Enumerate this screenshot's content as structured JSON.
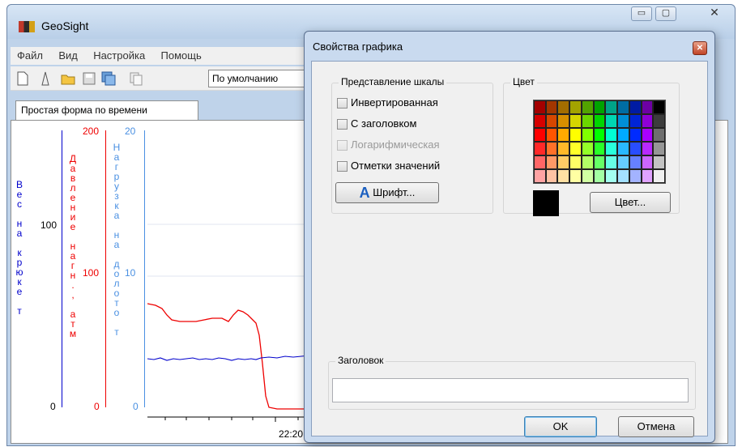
{
  "app": {
    "title": "GeoSight"
  },
  "menu": [
    "Файл",
    "Вид",
    "Настройка",
    "Помощь"
  ],
  "toolbar": {
    "preset": "По умолчанию"
  },
  "tabs": {
    "active": "Простая форма по времени"
  },
  "scales": {
    "weight": {
      "label": "Вес на крюке  т",
      "color": "#0000cc",
      "ticks": [
        "100",
        "0"
      ]
    },
    "pressure": {
      "label": "Давление нагн., атм",
      "color": "#ee0000",
      "ticks": [
        "200",
        "100",
        "0"
      ]
    },
    "load": {
      "label": "Нагрузка на долото  т",
      "color": "#4a90e2",
      "ticks": [
        "20",
        "10",
        "0"
      ]
    }
  },
  "timeaxis": {
    "label": "22:20"
  },
  "dialog": {
    "title": "Свойства графика",
    "scale_group": {
      "title": "Представление шкалы",
      "options": [
        {
          "label": "Инвертированная",
          "checked": false,
          "enabled": true
        },
        {
          "label": "С заголовком",
          "checked": false,
          "enabled": true
        },
        {
          "label": "Логарифмическая",
          "checked": false,
          "enabled": false
        },
        {
          "label": "Отметки значений",
          "checked": false,
          "enabled": true
        }
      ],
      "font_button": "Шрифт..."
    },
    "color_group": {
      "title": "Цвет",
      "color_button": "Цвет...",
      "selected_color": "#000000"
    },
    "heading_group": {
      "title": "Заголовок",
      "value": ""
    },
    "ok": "OK",
    "cancel": "Отмена"
  }
}
